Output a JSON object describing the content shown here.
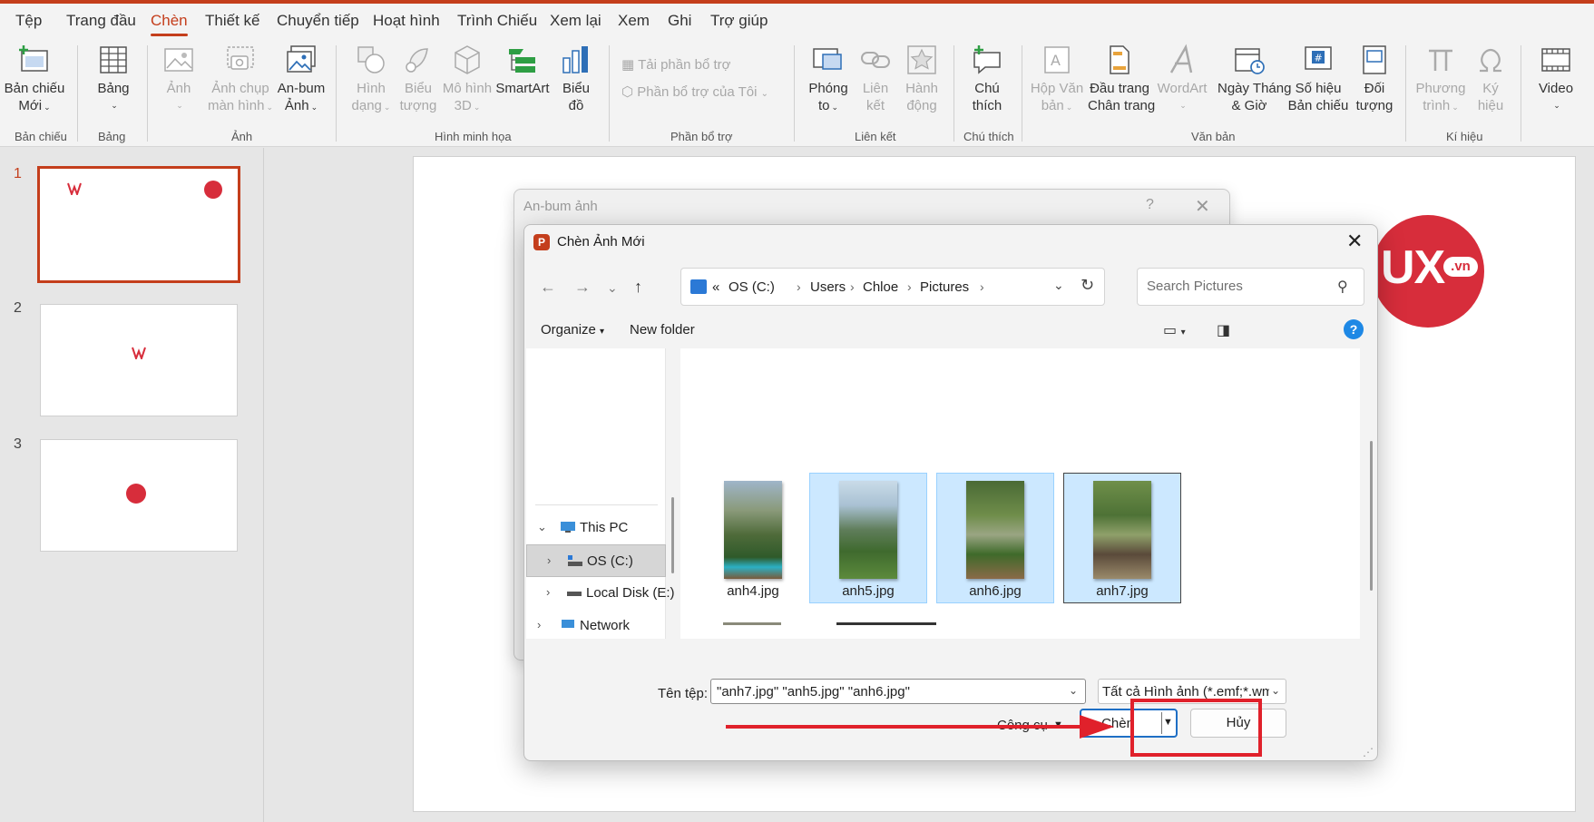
{
  "menu": {
    "tabs": [
      "Tệp",
      "Trang đầu",
      "Chèn",
      "Thiết kế",
      "Chuyển tiếp",
      "Hoạt hình",
      "Trình Chiếu",
      "Xem lại",
      "Xem",
      "Ghi",
      "Trợ giúp"
    ],
    "active": "Chèn"
  },
  "ribbon": {
    "new_slide": [
      "Bản chiếu",
      "Mới"
    ],
    "table": "Bảng",
    "picture": "Ảnh",
    "screenshot": [
      "Ảnh chụp",
      "màn hình"
    ],
    "album": [
      "An-bum",
      "Ảnh"
    ],
    "shapes": [
      "Hình",
      "dạng"
    ],
    "icons": [
      "Biểu",
      "tượng"
    ],
    "models3d": [
      "Mô hình",
      "3D"
    ],
    "smartart": "SmartArt",
    "chart": [
      "Biểu",
      "đồ"
    ],
    "get_addins": "Tải phần bổ trợ",
    "my_addins": "Phần bổ trợ của Tôi",
    "zoom": [
      "Phóng",
      "to"
    ],
    "link": [
      "Liên",
      "kết"
    ],
    "action": [
      "Hành",
      "động"
    ],
    "comment": [
      "Chú",
      "thích"
    ],
    "textbox": [
      "Hộp Văn",
      "bản"
    ],
    "header_footer": [
      "Đầu trang",
      "Chân trang"
    ],
    "wordart": "WordArt",
    "datetime": [
      "Ngày Tháng",
      "& Giờ"
    ],
    "slide_number": [
      "Số hiệu",
      "Bản chiếu"
    ],
    "object": [
      "Đối",
      "tượng"
    ],
    "equation": [
      "Phương",
      "trình"
    ],
    "symbol": [
      "Ký",
      "hiệu"
    ],
    "video": "Video",
    "groups": {
      "slides": "Bản chiếu",
      "tables": "Bảng",
      "images": "Ảnh",
      "illustrations": "Hình minh họa",
      "addins": "Phần bổ trợ",
      "links": "Liên kết",
      "comments": "Chú thích",
      "text": "Văn bản",
      "symbols": "Kí hiệu"
    }
  },
  "slides_panel": {
    "numbers": [
      "1",
      "2",
      "3"
    ],
    "active": 1
  },
  "album_dialog": {
    "title": "An-bum ảnh",
    "help": "?",
    "close": "✕"
  },
  "file_dialog": {
    "title": "Chèn Ảnh Mới",
    "address": [
      "«",
      "OS (C:)",
      "Users",
      "Chloe",
      "Pictures"
    ],
    "search_placeholder": "Search Pictures",
    "organize": "Organize",
    "new_folder": "New folder",
    "nav_tree": [
      {
        "label": "This PC",
        "expanded": true
      },
      {
        "label": "OS (C:)",
        "selected": true
      },
      {
        "label": "Local Disk (E:)"
      },
      {
        "label": "Network"
      }
    ],
    "files": [
      {
        "name": "anh4.jpg",
        "selected": false
      },
      {
        "name": "anh5.jpg",
        "selected": true
      },
      {
        "name": "anh6.jpg",
        "selected": true
      },
      {
        "name": "anh7.jpg",
        "selected": true,
        "focused": true
      }
    ],
    "filename_label": "Tên tệp:",
    "filename_value": "\"anh7.jpg\" \"anh5.jpg\" \"anh6.jpg\"",
    "filetype_value": "Tất cả Hình ảnh (*.emf;*.wmf;*.jpg",
    "tools_label": "Công cụ",
    "insert_label": "Chèn",
    "cancel_label": "Hủy"
  },
  "colors": {
    "accent": "#c43e1c",
    "highlight": "#e0212b",
    "selection": "#cce8ff",
    "ux_red": "#d72d3b"
  },
  "logo": {
    "ux": "UX",
    "vn": ".vn"
  }
}
